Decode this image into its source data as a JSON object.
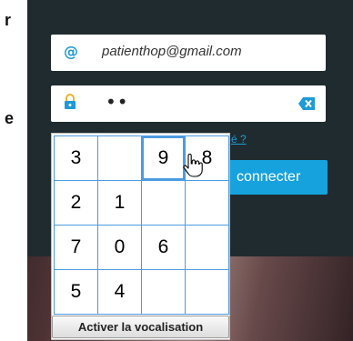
{
  "left_fragments": [
    "r",
    "e"
  ],
  "email_field": {
    "icon": "@",
    "value": "patienthop@gmail.com"
  },
  "password_field": {
    "masked_value": "••"
  },
  "forgot_link": "é ?",
  "connect_button": "connecter",
  "keypad": {
    "keys": [
      "3",
      "",
      "9",
      "8",
      "2",
      "1",
      "",
      "",
      "7",
      "0",
      "6",
      "",
      "5",
      "4",
      "",
      ""
    ],
    "active_key": "9",
    "vocalisation_button": "Activer la vocalisation"
  },
  "colors": {
    "accent": "#16a2dc",
    "panel_bg": "#1f2b2f",
    "keypad_border": "#4d9be0"
  }
}
